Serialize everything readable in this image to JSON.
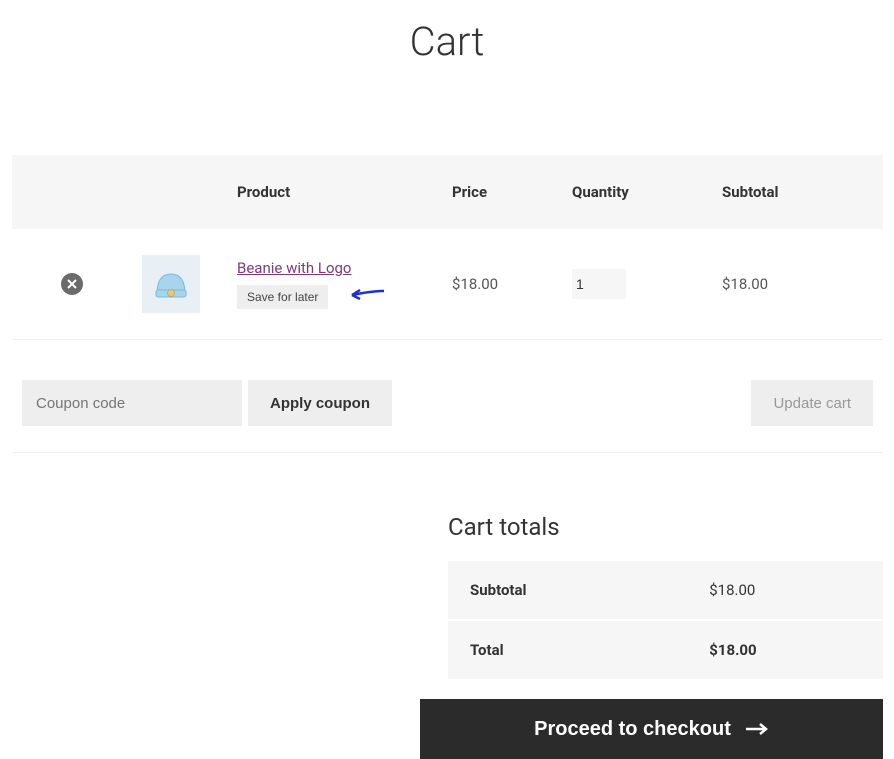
{
  "page_title": "Cart",
  "headers": {
    "product": "Product",
    "price": "Price",
    "quantity": "Quantity",
    "subtotal": "Subtotal"
  },
  "item": {
    "name": "Beanie with Logo",
    "save_label": "Save for later",
    "price": "$18.00",
    "quantity": "1",
    "subtotal": "$18.00"
  },
  "coupon": {
    "placeholder": "Coupon code",
    "apply_label": "Apply coupon"
  },
  "update_label": "Update cart",
  "totals": {
    "title": "Cart totals",
    "subtotal_label": "Subtotal",
    "subtotal_value": "$18.00",
    "total_label": "Total",
    "total_value": "$18.00"
  },
  "checkout_label": "Proceed to checkout"
}
